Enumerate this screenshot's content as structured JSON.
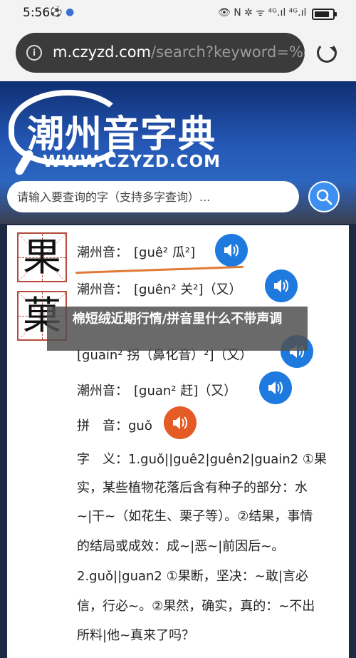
{
  "status": {
    "time": "5:56",
    "right_icons": "👁 N ✲ ᯤ ⁴ᴳ.ıl ⁴ᴳ.ıl",
    "battery_level": 0.85
  },
  "browser": {
    "url_host": "m.czyzd.com",
    "url_path": "/search?keyword=%e€"
  },
  "hero": {
    "title": "潮州音字典",
    "domain": "WWW.CZYZD.COM"
  },
  "search": {
    "placeholder": "请输入要查询的字（支持多字查询）..."
  },
  "characters": [
    "果",
    "菓"
  ],
  "pronunciations": [
    {
      "label": "潮州音：",
      "value": "[guê²  瓜²]"
    },
    {
      "label": "潮州音：",
      "value": "[guên²  关²]（又）"
    },
    {
      "label": "",
      "value": "[guain²  拐（鼻化音）²]（又）"
    },
    {
      "label": "潮州音：",
      "value": "[guan²  赶]（又）"
    },
    {
      "label": "拼　音：",
      "value": "guǒ"
    }
  ],
  "definition": {
    "lines": [
      "字　义：1.guǒ||guê2|guên2|guain2 ①果",
      "实，某些植物花落后含有种子的部分：水",
      "~|干~（如花生、栗子等）。②结果，事情",
      "的结局或成效：成~|恶~|前因后~。",
      "2.guǒ||guan2 ①果断，坚决：~敢|言必",
      "信，行必~。②果然，确实，真的：~不出",
      "所料|他~真来了吗？"
    ]
  },
  "banner": {
    "text": "棉短绒近期行情/拼音里什么不带声调"
  }
}
